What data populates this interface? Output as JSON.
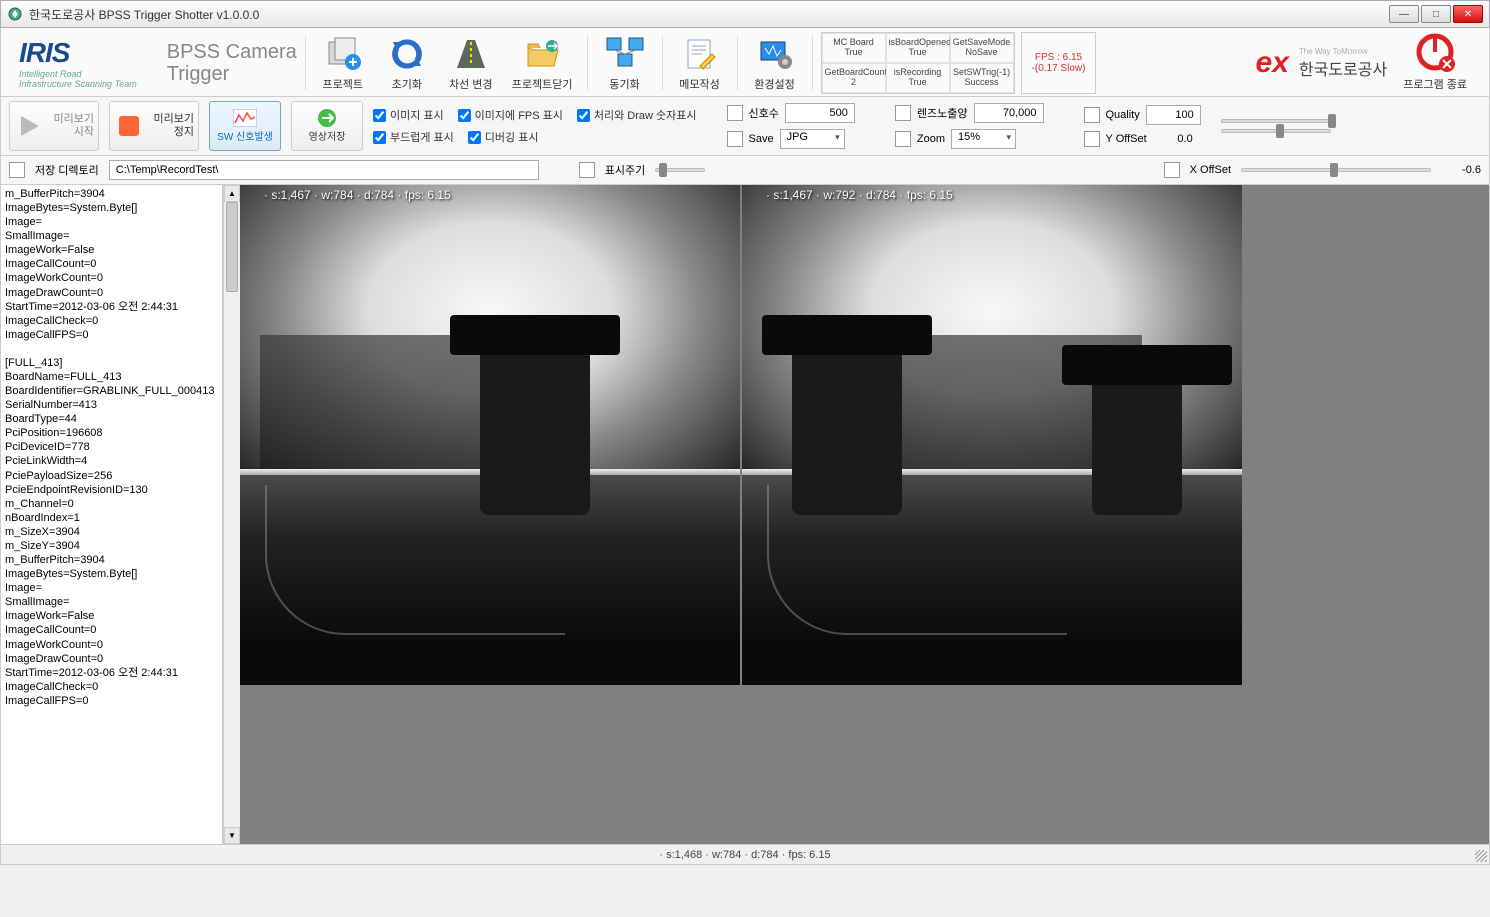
{
  "window": {
    "title": "한국도로공사 BPSS Trigger Shotter v1.0.0.0"
  },
  "brand": {
    "logo": "IRIS",
    "sub": "Intelligent Road\nInfrastructure Scanning Team",
    "title_line1": "BPSS Camera",
    "title_line2": "Trigger",
    "ex": "ex",
    "kec_small": "The Way ToMorrow",
    "kec": "한국도로공사"
  },
  "ribbon": {
    "items": [
      "프로젝트",
      "초기화",
      "차선 변경",
      "프로젝트닫기",
      "동기화",
      "메모작성",
      "환경설정"
    ],
    "exit": "프로그램 종료"
  },
  "status": {
    "cells": [
      {
        "k": "MC Board",
        "v": "True"
      },
      {
        "k": "isBoardOpened",
        "v": "True"
      },
      {
        "k": "GetSaveMode",
        "v": "NoSave"
      },
      {
        "k": "GetBoardCount",
        "v": "2"
      },
      {
        "k": "isRecording",
        "v": "True"
      },
      {
        "k": "SetSWTrig(-1)",
        "v": "Success"
      }
    ],
    "fps_line1": "FPS : 6.15",
    "fps_line2": "-(0.17 Slow)"
  },
  "second": {
    "preview_start": "미리보기\n시작",
    "preview_stop": "미리보기\n정지",
    "sw_signal": "SW 신호발생",
    "save_video": "영상저장",
    "chk1": "이미지 표시",
    "chk2": "이미지에 FPS 표시",
    "chk3": "처리와 Draw 숫자표시",
    "chk4": "부드럽게 표시",
    "chk5": "디버깅 표시",
    "signal_count_lbl": "신호수",
    "signal_count_val": "500",
    "save_lbl": "Save",
    "save_format": "JPG",
    "lens_lbl": "렌즈노출양",
    "lens_val": "70,000",
    "zoom_lbl": "Zoom",
    "zoom_val": "15%",
    "quality_lbl": "Quality",
    "quality_val": "100",
    "yoff_lbl": "Y OffSet",
    "yoff_val": "0.0"
  },
  "third": {
    "savedir_lbl": "저장 디렉토리",
    "savedir_val": "C:\\Temp\\RecordTest\\",
    "cycle_lbl": "표시주기",
    "xoff_lbl": "X OffSet",
    "xoff_val": "-0.6"
  },
  "log": "m_BufferPitch=3904\nImageBytes=System.Byte[]\nImage=\nSmallImage=\nImageWork=False\nImageCallCount=0\nImageWorkCount=0\nImageDrawCount=0\nStartTime=2012-03-06 오전 2:44:31\nImageCallCheck=0\nImageCallFPS=0\n\n[FULL_413]\nBoardName=FULL_413\nBoardIdentifier=GRABLINK_FULL_000413\nSerialNumber=413\nBoardType=44\nPciPosition=196608\nPciDeviceID=778\nPcieLinkWidth=4\nPciePayloadSize=256\nPcieEndpointRevisionID=130\nm_Channel=0\nnBoardIndex=1\nm_SizeX=3904\nm_SizeY=3904\nm_BufferPitch=3904\nImageBytes=System.Byte[]\nImage=\nSmallImage=\nImageWork=False\nImageCallCount=0\nImageWorkCount=0\nImageDrawCount=0\nStartTime=2012-03-06 오전 2:44:31\nImageCallCheck=0\nImageCallFPS=0",
  "overlay": {
    "left": "· s:1,467 · w:784 · d:784 · fps: 6.15",
    "right": "· s:1,467 · w:792 · d:784 · fps: 6.15"
  },
  "statusbar": "· s:1,468 · w:784 · d:784 · fps: 6.15"
}
